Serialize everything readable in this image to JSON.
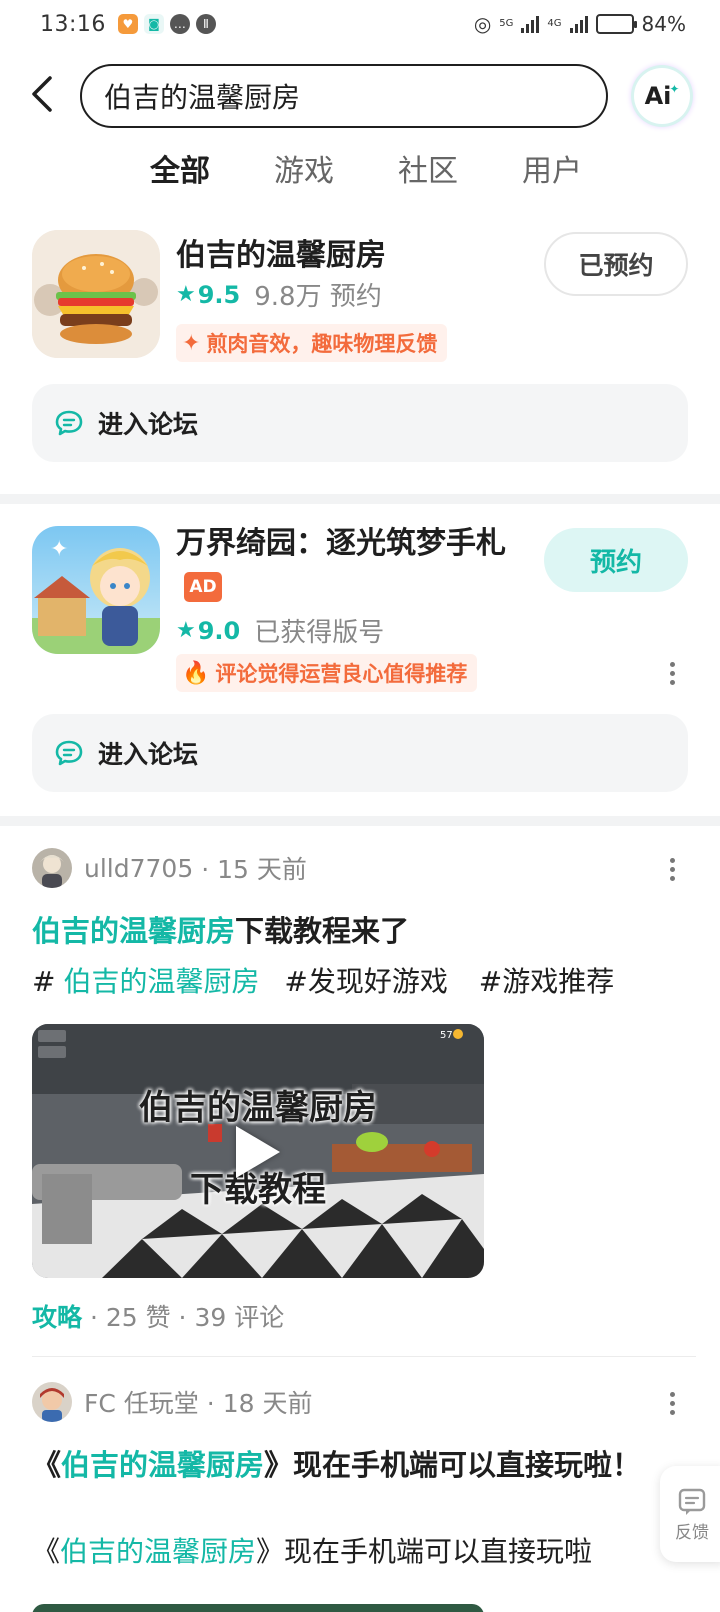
{
  "status_bar": {
    "time": "13:16",
    "network_a": "5G",
    "network_b": "4G",
    "battery": "84%"
  },
  "search": {
    "query": "伯吉的温馨厨房",
    "ai_label": "Ai"
  },
  "tabs": [
    {
      "label": "全部",
      "active": true
    },
    {
      "label": "游戏",
      "active": false
    },
    {
      "label": "社区",
      "active": false
    },
    {
      "label": "用户",
      "active": false
    }
  ],
  "games": [
    {
      "title": "伯吉的温馨厨房",
      "score": "9.5",
      "stat": "9.8万 预约",
      "tag": "煎肉音效，趣味物理反馈",
      "button": "已预约",
      "forum": "进入论坛"
    },
    {
      "title": "万界绮园：逐光筑梦手札",
      "ad": "AD",
      "score": "9.0",
      "stat": "已获得版号",
      "tag": "评论觉得运营良心值得推荐",
      "button": "预约",
      "forum": "进入论坛"
    }
  ],
  "posts": [
    {
      "author": "ulld7705",
      "time": "· 15 天前",
      "title_highlight": "伯吉的温馨厨房",
      "title_rest": "下载教程来了",
      "tags": [
        "#",
        "伯吉的温馨厨房",
        "#发现好游戏",
        "#游戏推荐"
      ],
      "video_title_1": "伯吉的温馨厨房",
      "video_title_2": "下载教程",
      "video_hud_right": "57",
      "category": "攻略",
      "stats": " · 25 赞 · 39 评论"
    },
    {
      "author": "FC 任玩堂",
      "time": "· 18 天前",
      "title_open": "《",
      "title_highlight": "伯吉的温馨厨房",
      "title_rest": "》现在手机端可以直接玩啦！",
      "body_open": "《",
      "body_highlight": "伯吉的温馨厨房",
      "body_rest": "》现在手机端可以直接玩啦"
    }
  ],
  "feedback_label": "反馈",
  "colors": {
    "accent": "#14b8a6",
    "tag_orange": "#f36b3c"
  }
}
